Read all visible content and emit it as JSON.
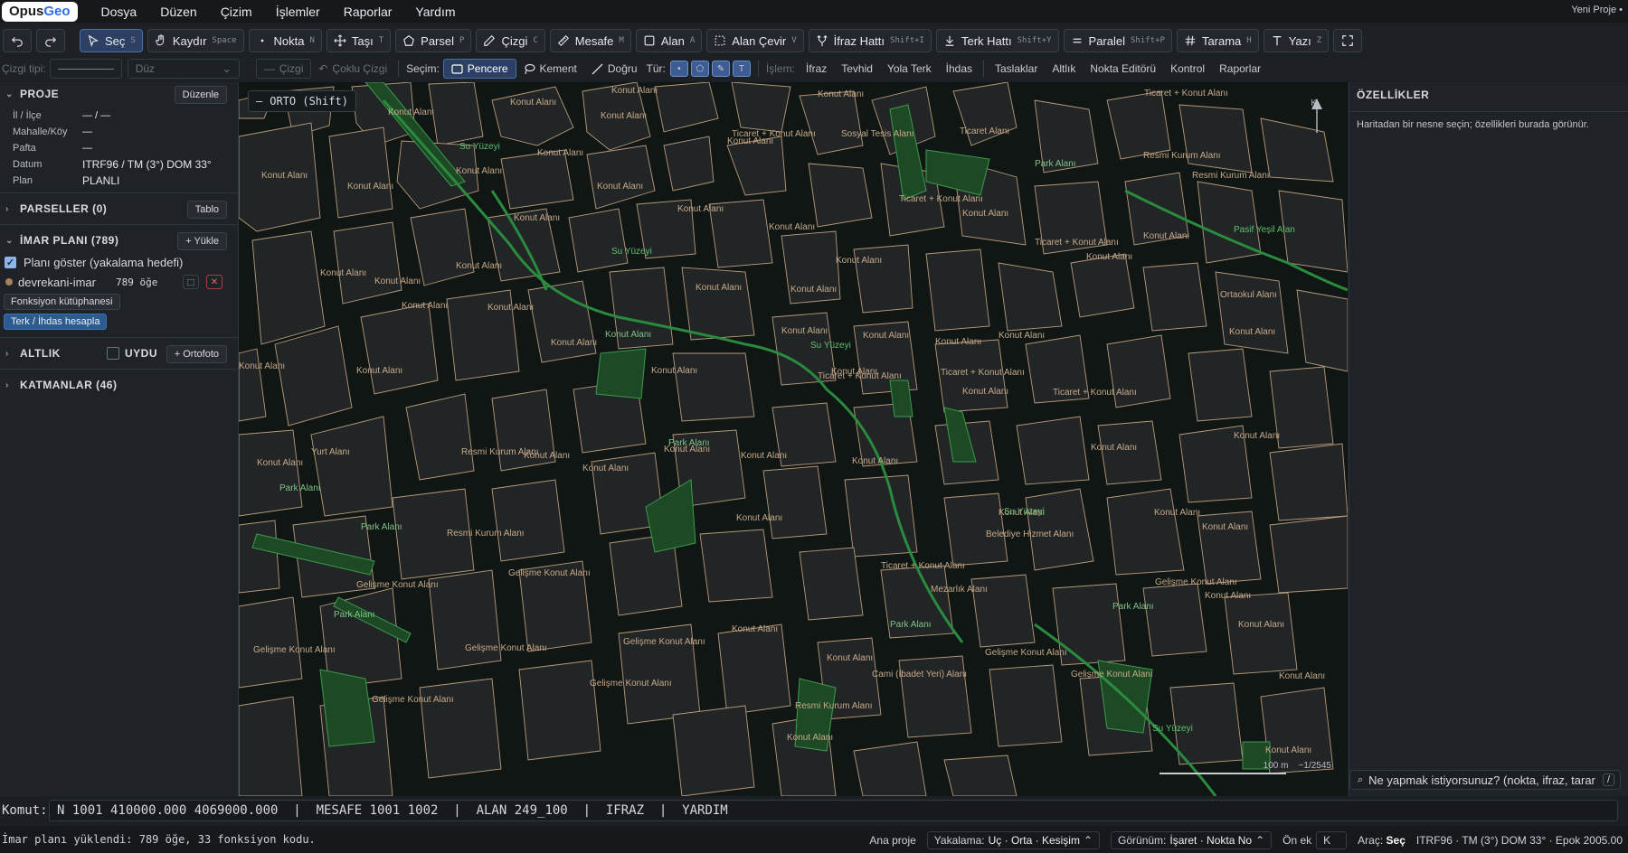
{
  "menubar": {
    "logo": "OpusGeo",
    "items": [
      "Dosya",
      "Düzen",
      "Çizim",
      "İşlemler",
      "Raporlar",
      "Yardım"
    ],
    "project": "Yeni Proje •"
  },
  "toolbar": {
    "tools": [
      {
        "label": "Seç",
        "key": "S",
        "icon": "cursor-icon",
        "active": true
      },
      {
        "label": "Kaydır",
        "key": "Space",
        "icon": "hand-icon"
      },
      {
        "label": "Nokta",
        "key": "N",
        "icon": "dot-icon"
      },
      {
        "label": "Taşı",
        "key": "T",
        "icon": "move-icon"
      },
      {
        "label": "Parsel",
        "key": "P",
        "icon": "pentagon-icon"
      },
      {
        "label": "Çizgi",
        "key": "C",
        "icon": "pencil-icon"
      },
      {
        "label": "Mesafe",
        "key": "M",
        "icon": "ruler-icon"
      },
      {
        "label": "Alan",
        "key": "A",
        "icon": "square-icon"
      },
      {
        "label": "Alan Çevir",
        "key": "V",
        "icon": "dashed-square-icon"
      },
      {
        "label": "İfraz Hattı",
        "key": "Shift+I",
        "icon": "split-icon"
      },
      {
        "label": "Terk Hattı",
        "key": "Shift+Y",
        "icon": "download-icon"
      },
      {
        "label": "Paralel",
        "key": "Shift+P",
        "icon": "parallel-icon"
      },
      {
        "label": "Tarama",
        "key": "H",
        "icon": "hash-icon"
      },
      {
        "label": "Yazı",
        "key": "Z",
        "icon": "text-icon"
      }
    ]
  },
  "optbar": {
    "line_type_label": "Çizgi tipi:",
    "line_style": "Düz",
    "draw_line": "Çizgi",
    "draw_multi": "Çoklu Çizgi",
    "selection_label": "Seçim:",
    "sel_window": "Pencere",
    "sel_lasso": "Kement",
    "sel_line": "Doğru",
    "type_label": "Tür:",
    "ops_label": "İşlem:",
    "ops": [
      "İfraz",
      "Tevhid",
      "Yola Terk",
      "İhdas"
    ],
    "extras": [
      "Taslaklar",
      "Altlık",
      "Nokta Editörü",
      "Kontrol",
      "Raporlar"
    ]
  },
  "left": {
    "proje": {
      "title": "PROJE",
      "edit": "Düzenle",
      "rows": [
        {
          "k": "İl / İlçe",
          "v": "— / —"
        },
        {
          "k": "Mahalle/Köy",
          "v": "—"
        },
        {
          "k": "Pafta",
          "v": "—"
        },
        {
          "k": "Datum",
          "v": "ITRF96 / TM (3°) DOM 33°"
        },
        {
          "k": "Plan",
          "v": "PLANLI"
        }
      ]
    },
    "parseller": {
      "title": "PARSELLER (0)",
      "btn": "Tablo"
    },
    "imar": {
      "title": "İMAR PLANI (789)",
      "btn": "+ Yükle",
      "show_plan": "Planı göster (yakalama hedefi)",
      "layer_name": "devrekani-imar",
      "layer_count": "789 öğe",
      "lib": "Fonksiyon kütüphanesi",
      "calc": "Terk / İhdas hesapla"
    },
    "altlik": {
      "title": "ALTLIK",
      "uydu": "UYDU",
      "ortofoto": "+ Ortofoto"
    },
    "katmanlar": {
      "title": "KATMANLAR (46)"
    }
  },
  "map": {
    "orto": "ORTO (Shift)",
    "north": "K",
    "scale_m": "100 m",
    "scale_ratio": "~1/2545",
    "labels": [
      "Konut Alanı",
      "Ticaret + Konut Alanı",
      "Sosyal Tesis Alanı",
      "Park Alanı",
      "Resmi Kurum Alanı",
      "Su Yüzeyi",
      "Pasif Yeşil Alan",
      "Ortaokul Alanı",
      "Yurt Alanı",
      "Gelişme Konut Alanı",
      "Belediye Hizmet Alanı",
      "Mezarlık Alanı",
      "Cami (İbadet Yeri) Alanı",
      "Ticaret Alanı"
    ]
  },
  "right": {
    "title": "ÖZELLİKLER",
    "hint": "Haritadan bir nesne seçin; özellikleri burada görünür.",
    "ask": "Ne yapmak istiyorsunuz? (nokta, ifraz, tarar",
    "ask_key": "/"
  },
  "command": {
    "label": "Komut:",
    "value": "N 1001 410000.000 4069000.000  |  MESAFE 1001 1002  |  ALAN 249_100  |  IFRAZ  |  YARDIM"
  },
  "status": {
    "msg": "İmar planı yüklendi: 789 öğe, 33 fonksiyon kodu.",
    "ana": "Ana proje",
    "snap_label": "Yakalama:",
    "snap_value": "Uç · Orta · Kesişim",
    "view_label": "Görünüm:",
    "view_value": "İşaret · Nokta No",
    "prefix_label": "Ön ek",
    "prefix_value": "K",
    "tool_label": "Araç:",
    "tool_value": "Seç",
    "crs": "ITRF96 · TM (3°) DOM 33° · Epok 2005.00"
  },
  "colors": {
    "accent": "#2c5c8f",
    "park": "#1f5a2c",
    "water": "#2a8a3e",
    "parcel_stroke": "#b89a7a"
  }
}
